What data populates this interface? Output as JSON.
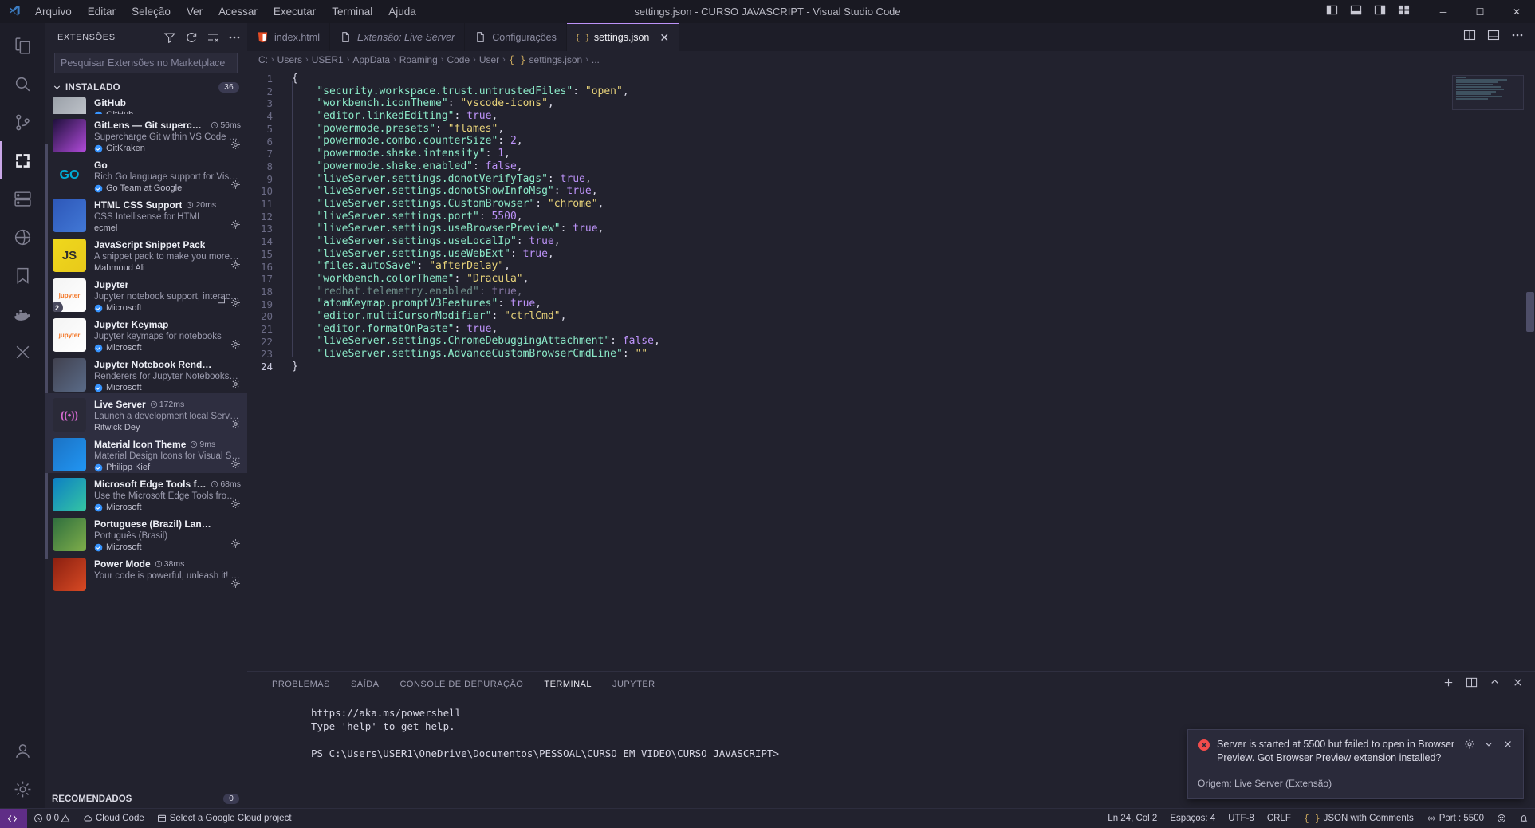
{
  "window": {
    "title": "settings.json - CURSO JAVASCRIPT - Visual Studio Code",
    "minimize_label": "─",
    "maximize_label": "☐",
    "close_label": "✕"
  },
  "menubar": {
    "items": [
      {
        "label": "Arquivo"
      },
      {
        "label": "Editar"
      },
      {
        "label": "Seleção"
      },
      {
        "label": "Ver"
      },
      {
        "label": "Acessar"
      },
      {
        "label": "Executar"
      },
      {
        "label": "Terminal"
      },
      {
        "label": "Ajuda"
      }
    ]
  },
  "activitybar": {
    "items": [
      {
        "name": "explorer",
        "icon": "files-icon",
        "active": false
      },
      {
        "name": "search",
        "icon": "search-icon",
        "active": false
      },
      {
        "name": "source-control",
        "icon": "source-control-icon",
        "active": false
      },
      {
        "name": "extensions",
        "icon": "extensions-icon",
        "active": true
      },
      {
        "name": "remote-explorer",
        "icon": "remote-explorer-icon",
        "active": false
      },
      {
        "name": "azure",
        "icon": "azure-icon",
        "active": false
      },
      {
        "name": "bookmarks",
        "icon": "bookmark-icon",
        "active": false
      },
      {
        "name": "docker",
        "icon": "docker-icon",
        "active": false
      },
      {
        "name": "test-explorer",
        "icon": "beaker-icon",
        "active": false
      }
    ],
    "bottom": [
      {
        "name": "accounts",
        "icon": "account-icon"
      },
      {
        "name": "manage",
        "icon": "gear-icon"
      }
    ]
  },
  "sidebar": {
    "title": "EXTENSÕES",
    "actions": [
      {
        "name": "filter-icon"
      },
      {
        "name": "refresh-icon"
      },
      {
        "name": "clear-list-icon"
      },
      {
        "name": "more-actions-icon"
      }
    ],
    "search": {
      "placeholder": "Pesquisar Extensões no Marketplace",
      "value": ""
    },
    "installed_section": {
      "label": "INSTALADO",
      "count": "36"
    },
    "recommended_section": {
      "label": "RECOMENDADOS",
      "count": "0"
    },
    "extensions": [
      {
        "name": "GitHub",
        "desc": "",
        "publisher": "GitHub",
        "verified": true,
        "time": "",
        "color1": "#9aa0a8",
        "color2": "#c8ccd2",
        "glyph": "",
        "partial": true,
        "selected": false,
        "badge": ""
      },
      {
        "name": "GitLens — Git supercharged",
        "desc": "Supercharge Git within VS Code — Vis...",
        "publisher": "GitKraken",
        "verified": true,
        "time": "56ms",
        "color1": "#1d0f3a",
        "color2": "#b24bdb",
        "glyph": "",
        "selected": false,
        "badge": ""
      },
      {
        "name": "Go",
        "desc": "Rich Go language support for Visual St...",
        "publisher": "Go Team at Google",
        "verified": true,
        "time": "",
        "color1": "#22222e",
        "color2": "#22222e",
        "glyph": "GO",
        "selected": false,
        "badge": ""
      },
      {
        "name": "HTML CSS Support",
        "desc": "CSS Intellisense for HTML",
        "publisher": "ecmel",
        "verified": false,
        "time": "20ms",
        "color1": "#2d57b8",
        "color2": "#4278d6",
        "glyph": "",
        "selected": false,
        "badge": ""
      },
      {
        "name": "JavaScript Snippet Pack",
        "desc": "A snippet pack to make you more pro...",
        "publisher": "Mahmoud Ali",
        "verified": false,
        "time": "",
        "color1": "#efd81d",
        "color2": "#e8c91a",
        "glyph": "JS",
        "selected": false,
        "badge": ""
      },
      {
        "name": "Jupyter",
        "desc": "Jupyter notebook support, interactive ...",
        "publisher": "Microsoft",
        "verified": true,
        "time": "",
        "color1": "#f4f4f4",
        "color2": "#ffffff",
        "glyph": "jupyter",
        "selected": false,
        "badge": "2"
      },
      {
        "name": "Jupyter Keymap",
        "desc": "Jupyter keymaps for notebooks",
        "publisher": "Microsoft",
        "verified": true,
        "time": "",
        "color1": "#f4f4f4",
        "color2": "#ffffff",
        "glyph": "jupyter",
        "selected": false,
        "badge": ""
      },
      {
        "name": "Jupyter Notebook Renderers",
        "desc": "Renderers for Jupyter Notebooks (with...",
        "publisher": "Microsoft",
        "verified": true,
        "time": "",
        "color1": "#41414f",
        "color2": "#5a6b88",
        "glyph": "",
        "selected": false,
        "badge": ""
      },
      {
        "name": "Live Server",
        "desc": "Launch a development local Server wit...",
        "publisher": "Ritwick Dey",
        "verified": false,
        "time": "172ms",
        "color1": "#2a2a38",
        "color2": "#2a2a38",
        "glyph": "((•))",
        "selected": true,
        "badge": ""
      },
      {
        "name": "Material Icon Theme",
        "desc": "Material Design Icons for Visual Studio...",
        "publisher": "Philipp Kief",
        "verified": true,
        "time": "9ms",
        "color1": "#1b72c4",
        "color2": "#2196f3",
        "glyph": "",
        "selected": true,
        "badge": ""
      },
      {
        "name": "Microsoft Edge Tools for VS ...",
        "desc": "Use the Microsoft Edge Tools from wit...",
        "publisher": "Microsoft",
        "verified": true,
        "time": "68ms",
        "color1": "#0c7ec4",
        "color2": "#35c6a3",
        "glyph": "",
        "selected": false,
        "badge": ""
      },
      {
        "name": "Portuguese (Brazil) Language Pack ...",
        "desc": "Português (Brasil)",
        "publisher": "Microsoft",
        "verified": true,
        "time": "",
        "color1": "#2e6e3e",
        "color2": "#7fae4a",
        "glyph": "",
        "selected": false,
        "badge": ""
      },
      {
        "name": "Power Mode",
        "desc": "Your code is powerful, unleash it! The ...",
        "publisher": "",
        "verified": false,
        "time": "38ms",
        "color1": "#8a1f10",
        "color2": "#d84a24",
        "glyph": "",
        "selected": false,
        "badge": ""
      }
    ]
  },
  "editor": {
    "tabs": [
      {
        "label": "index.html",
        "icon": "html5-icon",
        "active": false,
        "italic": false,
        "closable": false
      },
      {
        "label": "Extensão: Live Server",
        "icon": "file-icon",
        "active": false,
        "italic": true,
        "closable": false
      },
      {
        "label": "Configurações",
        "icon": "file-icon",
        "active": false,
        "italic": false,
        "closable": false
      },
      {
        "label": "settings.json",
        "icon": "json-icon",
        "active": true,
        "italic": false,
        "closable": true
      }
    ],
    "tab_actions": [
      {
        "name": "split-editor-icon"
      },
      {
        "name": "toggle-panel-icon"
      },
      {
        "name": "more-actions-icon"
      }
    ],
    "breadcrumbs": [
      "C:",
      "Users",
      "USER1",
      "AppData",
      "Roaming",
      "Code",
      "User",
      "{ } settings.json",
      "..."
    ],
    "line_count": 24,
    "lines": [
      {
        "n": 1,
        "indent": 0,
        "html": "{"
      },
      {
        "n": 2,
        "indent": 1,
        "key": "security.workspace.trust.untrustedFiles",
        "value": "\"open\"",
        "vtype": "s",
        "comma": true
      },
      {
        "n": 3,
        "indent": 1,
        "key": "workbench.iconTheme",
        "value": "\"vscode-icons\"",
        "vtype": "s",
        "comma": true
      },
      {
        "n": 4,
        "indent": 1,
        "key": "editor.linkedEditing",
        "value": "true",
        "vtype": "b",
        "comma": true
      },
      {
        "n": 5,
        "indent": 1,
        "key": "powermode.presets",
        "value": "\"flames\"",
        "vtype": "s",
        "comma": true
      },
      {
        "n": 6,
        "indent": 1,
        "key": "powermode.combo.counterSize",
        "value": "2",
        "vtype": "b",
        "comma": true
      },
      {
        "n": 7,
        "indent": 1,
        "key": "powermode.shake.intensity",
        "value": "1",
        "vtype": "b",
        "comma": true
      },
      {
        "n": 8,
        "indent": 1,
        "key": "powermode.shake.enabled",
        "value": "false",
        "vtype": "b",
        "comma": true
      },
      {
        "n": 9,
        "indent": 1,
        "key": "liveServer.settings.donotVerifyTags",
        "value": "true",
        "vtype": "b",
        "comma": true
      },
      {
        "n": 10,
        "indent": 1,
        "key": "liveServer.settings.donotShowInfoMsg",
        "value": "true",
        "vtype": "b",
        "comma": true
      },
      {
        "n": 11,
        "indent": 1,
        "key": "liveServer.settings.CustomBrowser",
        "value": "\"chrome\"",
        "vtype": "s",
        "comma": true
      },
      {
        "n": 12,
        "indent": 1,
        "key": "liveServer.settings.port",
        "value": "5500",
        "vtype": "b",
        "comma": true
      },
      {
        "n": 13,
        "indent": 1,
        "key": "liveServer.settings.useBrowserPreview",
        "value": "true",
        "vtype": "b",
        "comma": true
      },
      {
        "n": 14,
        "indent": 1,
        "key": "liveServer.settings.useLocalIp",
        "value": "true",
        "vtype": "b",
        "comma": true
      },
      {
        "n": 15,
        "indent": 1,
        "key": "liveServer.settings.useWebExt",
        "value": "true",
        "vtype": "b",
        "comma": true
      },
      {
        "n": 16,
        "indent": 1,
        "key": "files.autoSave",
        "value": "\"afterDelay\"",
        "vtype": "s",
        "comma": true
      },
      {
        "n": 17,
        "indent": 1,
        "key": "workbench.colorTheme",
        "value": "\"Dracula\"",
        "vtype": "s",
        "comma": true
      },
      {
        "n": 18,
        "indent": 1,
        "key": "redhat.telemetry.enabled",
        "value": "true",
        "vtype": "b",
        "comma": true,
        "dim": true
      },
      {
        "n": 19,
        "indent": 1,
        "key": "atomKeymap.promptV3Features",
        "value": "true",
        "vtype": "b",
        "comma": true
      },
      {
        "n": 20,
        "indent": 1,
        "key": "editor.multiCursorModifier",
        "value": "\"ctrlCmd\"",
        "vtype": "s",
        "comma": true
      },
      {
        "n": 21,
        "indent": 1,
        "key": "editor.formatOnPaste",
        "value": "true",
        "vtype": "b",
        "comma": true
      },
      {
        "n": 22,
        "indent": 1,
        "key": "liveServer.settings.ChromeDebuggingAttachment",
        "value": "false",
        "vtype": "b",
        "comma": true
      },
      {
        "n": 23,
        "indent": 1,
        "key": "liveServer.settings.AdvanceCustomBrowserCmdLine",
        "value": "\"\"",
        "vtype": "s",
        "comma": false
      },
      {
        "n": 24,
        "indent": 0,
        "html": "}"
      }
    ]
  },
  "panel": {
    "tabs": [
      {
        "label": "PROBLEMAS",
        "active": false
      },
      {
        "label": "SAÍDA",
        "active": false
      },
      {
        "label": "CONSOLE DE DEPURAÇÃO",
        "active": false
      },
      {
        "label": "TERMINAL",
        "active": true
      },
      {
        "label": "JUPYTER",
        "active": false
      }
    ],
    "terminal_lines": [
      "https://aka.ms/powershell",
      "Type 'help' to get help.",
      "",
      "PS C:\\Users\\USER1\\OneDrive\\Documentos\\PESSOAL\\CURSO EM VIDEO\\CURSO JAVASCRIPT>"
    ]
  },
  "notification": {
    "icon": "error-icon",
    "message": "Server is started at 5500 but failed to open in Browser Preview. Got Browser Preview extension installed?",
    "source": "Origem: Live Server (Extensão)",
    "actions": [
      {
        "name": "gear-icon"
      },
      {
        "name": "chevron-down-icon"
      },
      {
        "name": "close-icon"
      }
    ]
  },
  "statusbar": {
    "remote": {
      "label": "",
      "icon": "remote-icon"
    },
    "left": [
      {
        "name": "problems",
        "label": "0  0",
        "icon": "error-warning-icon"
      },
      {
        "name": "cloud-code",
        "label": "Cloud Code",
        "icon": "cloud-icon"
      },
      {
        "name": "gcp-project",
        "label": "Select a Google Cloud project",
        "icon": "project-icon"
      }
    ],
    "right": [
      {
        "name": "cursor-position",
        "label": "Ln 24, Col 2"
      },
      {
        "name": "indentation",
        "label": "Espaços: 4"
      },
      {
        "name": "encoding",
        "label": "UTF-8"
      },
      {
        "name": "eol",
        "label": "CRLF"
      },
      {
        "name": "language-mode",
        "label": "JSON with Comments",
        "icon": "braces-icon"
      },
      {
        "name": "live-server-port",
        "label": "Port : 5500",
        "icon": "broadcast-icon"
      },
      {
        "name": "feedback",
        "label": "",
        "icon": "smiley-icon"
      },
      {
        "name": "notifications",
        "label": "",
        "icon": "bell-icon"
      }
    ]
  },
  "colors": {
    "accent": "#bd93f9",
    "bg": "#22222e",
    "titlebar_bg": "#191922",
    "remote_bg": "#5f2d86",
    "error": "#f14c4c"
  }
}
